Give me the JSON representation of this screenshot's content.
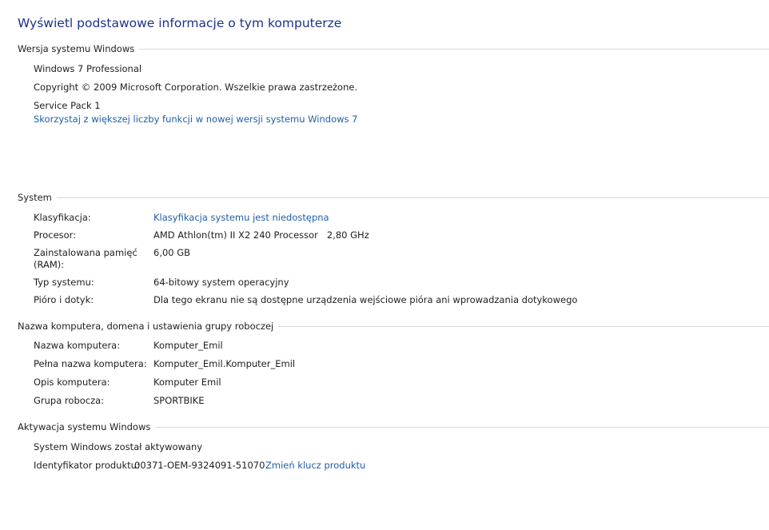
{
  "title": "Wyświetl podstawowe informacje o tym komputerze",
  "edition": {
    "heading": "Wersja systemu Windows",
    "name": "Windows 7 Professional",
    "copyright": "Copyright © 2009 Microsoft Corporation. Wszelkie prawa zastrzeżone.",
    "service_pack": "Service Pack 1",
    "upgrade_link": "Skorzystaj z większej liczby funkcji w nowej wersji systemu Windows 7"
  },
  "system": {
    "heading": "System",
    "rating_label": "Klasyfikacja:",
    "rating_value": "Klasyfikacja systemu jest niedostępna",
    "processor_label": "Procesor:",
    "processor_value": "AMD Athlon(tm) II X2 240 Processor   2,80 GHz",
    "ram_label_line1": "Zainstalowana pamięć",
    "ram_label_line2": "(RAM):",
    "ram_value": "6,00 GB",
    "type_label": "Typ systemu:",
    "type_value": "64-bitowy system operacyjny",
    "pen_label": "Pióro i dotyk:",
    "pen_value": "Dla tego ekranu nie są dostępne urządzenia wejściowe pióra ani wprowadzania dotykowego"
  },
  "computer": {
    "heading": "Nazwa komputera, domena i ustawienia grupy roboczej",
    "name_label": "Nazwa komputera:",
    "name_value": "Komputer_Emil",
    "full_name_label": "Pełna nazwa komputera:",
    "full_name_value": "Komputer_Emil.Komputer_Emil",
    "description_label": "Opis komputera:",
    "description_value": "Komputer Emil",
    "workgroup_label": "Grupa robocza:",
    "workgroup_value": "SPORTBIKE"
  },
  "activation": {
    "heading": "Aktywacja systemu Windows",
    "status": "System Windows został aktywowany",
    "product_id_label": "Identyfikator produktu:",
    "product_id_value": "00371-OEM-9324091-51070",
    "change_key_link": "Zmień klucz produktu"
  }
}
